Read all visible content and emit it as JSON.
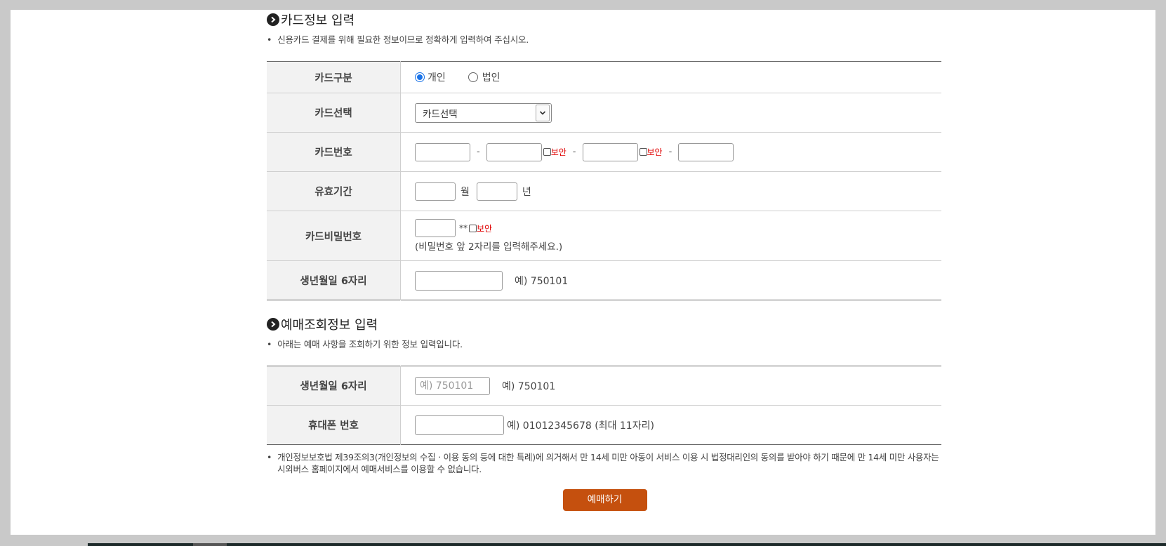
{
  "card_section": {
    "title": "카드정보 입력",
    "description": "신용카드 결제를 위해 필요한 정보이므로 정확하게 입력하여 주십시오.",
    "card_type": {
      "label": "카드구분",
      "options": [
        {
          "label": "개인",
          "selected": true
        },
        {
          "label": "법인",
          "selected": false
        }
      ]
    },
    "card_select": {
      "label": "카드선택",
      "value": "카드선택"
    },
    "card_number": {
      "label": "카드번호",
      "separator": "-",
      "secure_label": "보안"
    },
    "expiry": {
      "label": "유효기간",
      "month_unit": "월",
      "year_unit": "년"
    },
    "password": {
      "label": "카드비밀번호",
      "mask": "**",
      "secure_label": "보안",
      "hint": "(비밀번호 앞 2자리를 입력해주세요.)"
    },
    "birth": {
      "label": "생년월일 6자리",
      "example": "예) 750101"
    }
  },
  "lookup_section": {
    "title": "예매조회정보 입력",
    "description": "아래는 예매 사항을 조회하기 위한 정보 입력입니다.",
    "birth": {
      "label": "생년월일 6자리",
      "placeholder": "예) 750101",
      "example": "예) 750101"
    },
    "phone": {
      "label": "휴대폰 번호",
      "example": "예) 01012345678 (최대 11자리)"
    }
  },
  "notice": "개인정보보호법 제39조의3(개인정보의 수집ㆍ이용 동의 등에 대한 특례)에 의거해서 만 14세 미만 아동이 서비스 이용 시 법정대리인의 동의를 받아야 하기 때문에 만 14세 미만 사용자는 시외버스 홈페이지에서 예매서비스를 이용할 수 없습니다.",
  "bullet": "•",
  "submit_label": "예매하기",
  "colors": {
    "submit": "#c5500e",
    "secure": "#e00000",
    "radio": "#1a73e8"
  }
}
